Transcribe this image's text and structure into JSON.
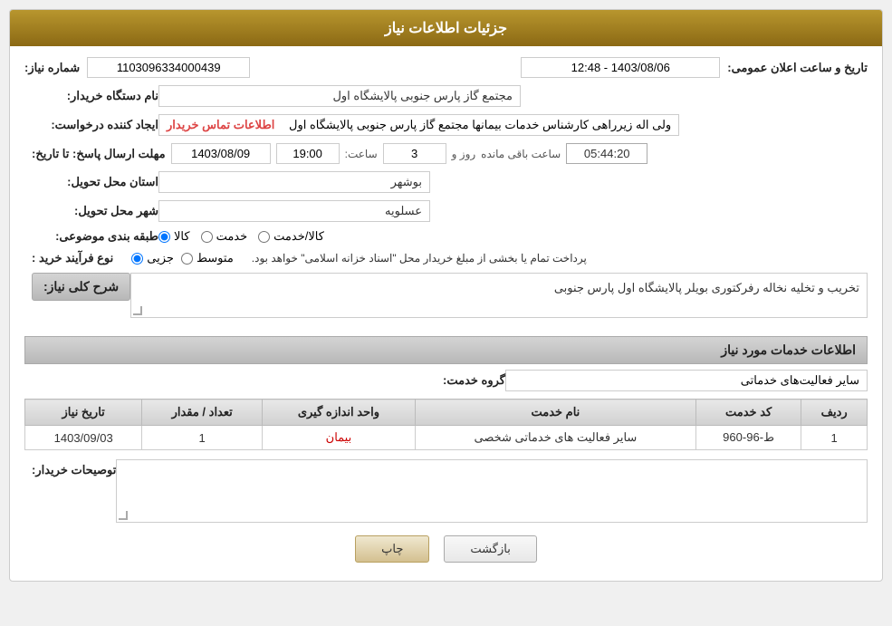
{
  "header": {
    "title": "جزئیات اطلاعات نیاز"
  },
  "fields": {
    "shmaare_niaz_label": "شماره نیاز:",
    "shmaare_niaz_value": "1103096334000439",
    "announce_label": "تاریخ و ساعت اعلان عمومی:",
    "announce_value": "1403/08/06 - 12:48",
    "buyer_name_label": "نام دستگاه خریدار:",
    "buyer_name_value": "مجتمع گاز پارس جنوبی  پالایشگاه اول",
    "creator_label": "ایجاد کننده درخواست:",
    "creator_value": "ولی اله زیرراهی کارشناس خدمات بیمانها مجتمع گاز پارس جنوبی  پالایشگاه اول",
    "creator_link_text": "اطلاعات تماس خریدار",
    "deadline_label": "مهلت ارسال پاسخ: تا تاریخ:",
    "deadline_date": "1403/08/09",
    "deadline_time_label": "ساعت:",
    "deadline_time": "19:00",
    "deadline_days_label": "روز و",
    "deadline_days": "3",
    "countdown_label": "ساعت باقی مانده",
    "countdown_value": "05:44:20",
    "province_label": "استان محل تحویل:",
    "province_value": "بوشهر",
    "city_label": "شهر محل تحویل:",
    "city_value": "عسلویه",
    "category_label": "طبقه بندی موضوعی:",
    "category_kala": "کالا",
    "category_khedmat": "خدمت",
    "category_kala_khedmat": "کالا/خدمت",
    "purchase_type_label": "نوع فرآیند خرید :",
    "purchase_jozii": "جزیی",
    "purchase_mottavasset": "متوسط",
    "purchase_note": "پرداخت تمام یا بخشی از مبلغ خریدار محل \"اسناد خزانه اسلامی\" خواهد بود.",
    "description_section_label": "شرح کلی نیاز:",
    "description_value": "تخریب و تخلیه نخاله رفرکتوری  بویلر پالایشگاه اول  پارس جنوبی",
    "services_section_label": "اطلاعات خدمات مورد نیاز",
    "service_group_label": "گروه خدمت:",
    "service_group_value": "سایر فعالیت‌های خدماتی",
    "table": {
      "col_radif": "ردیف",
      "col_code": "کد خدمت",
      "col_name": "نام خدمت",
      "col_unit": "واحد اندازه گیری",
      "col_qty": "تعداد / مقدار",
      "col_date": "تاریخ نیاز",
      "rows": [
        {
          "radif": "1",
          "code": "ط-96-960",
          "name": "سایر فعالیت های خدماتی شخصی",
          "unit": "بیمان",
          "qty": "1",
          "date": "1403/09/03"
        }
      ]
    },
    "buyer_notes_label": "توصیحات خریدار:",
    "buttons": {
      "back": "بازگشت",
      "print": "چاپ"
    }
  }
}
